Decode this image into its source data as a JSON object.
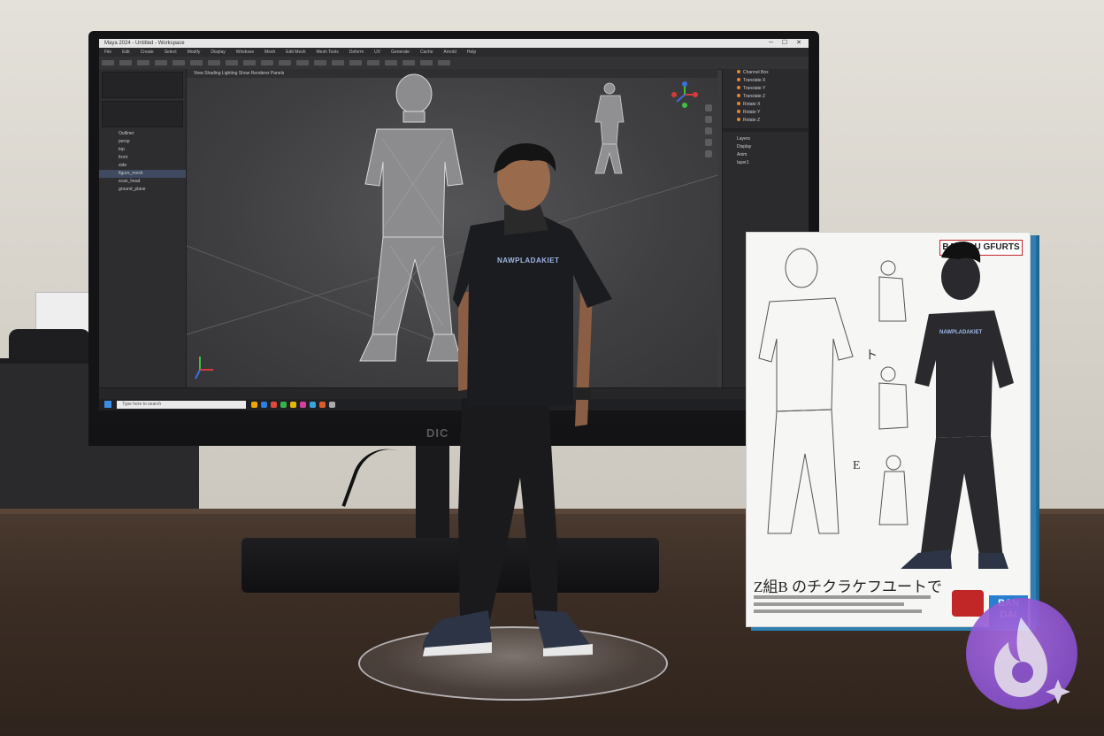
{
  "scene": {
    "description_tags": [
      "desk",
      "monitor",
      "figurine",
      "product-box"
    ]
  },
  "monitor": {
    "brand": "DIC",
    "app": {
      "title": "Maya 2024 - Untitled - Workspace",
      "menu": [
        "File",
        "Edit",
        "Create",
        "Select",
        "Modify",
        "Display",
        "Windows",
        "Mesh",
        "Edit Mesh",
        "Mesh Tools",
        "Deform",
        "UV",
        "Generate",
        "Cache",
        "Arnold",
        "Help"
      ],
      "viewport_header": "View  Shading  Lighting  Show  Renderer  Panels",
      "outliner": [
        "Outliner",
        "persp",
        "top",
        "front",
        "side",
        "figure_mesh",
        "scan_head",
        "ground_plane"
      ],
      "outliner_selected": "figure_mesh",
      "attributes": [
        "Channel Box",
        "Translate X",
        "Translate Y",
        "Translate Z",
        "Rotate X",
        "Rotate Y",
        "Rotate Z"
      ],
      "layers": [
        "Layers",
        "Display",
        "Anim",
        "layer1"
      ]
    },
    "taskbar": {
      "search_placeholder": "Type here to search",
      "icon_colors": [
        "#f0a800",
        "#2d7fe0",
        "#e04a3b",
        "#38b24a",
        "#e6b800",
        "#d63ea0",
        "#3aa0e0",
        "#e05a2a",
        "#aaaaaa"
      ]
    }
  },
  "figurine": {
    "shirt_text": "NAWPLADAKIET"
  },
  "box": {
    "brand": "BANDAU GFURTS",
    "shirt_text": "NAWPLADAKIET",
    "caption": "Z組B のチクラケフユートで",
    "markers": [
      "ト",
      "E"
    ],
    "logo_text": "BAN DAI"
  }
}
